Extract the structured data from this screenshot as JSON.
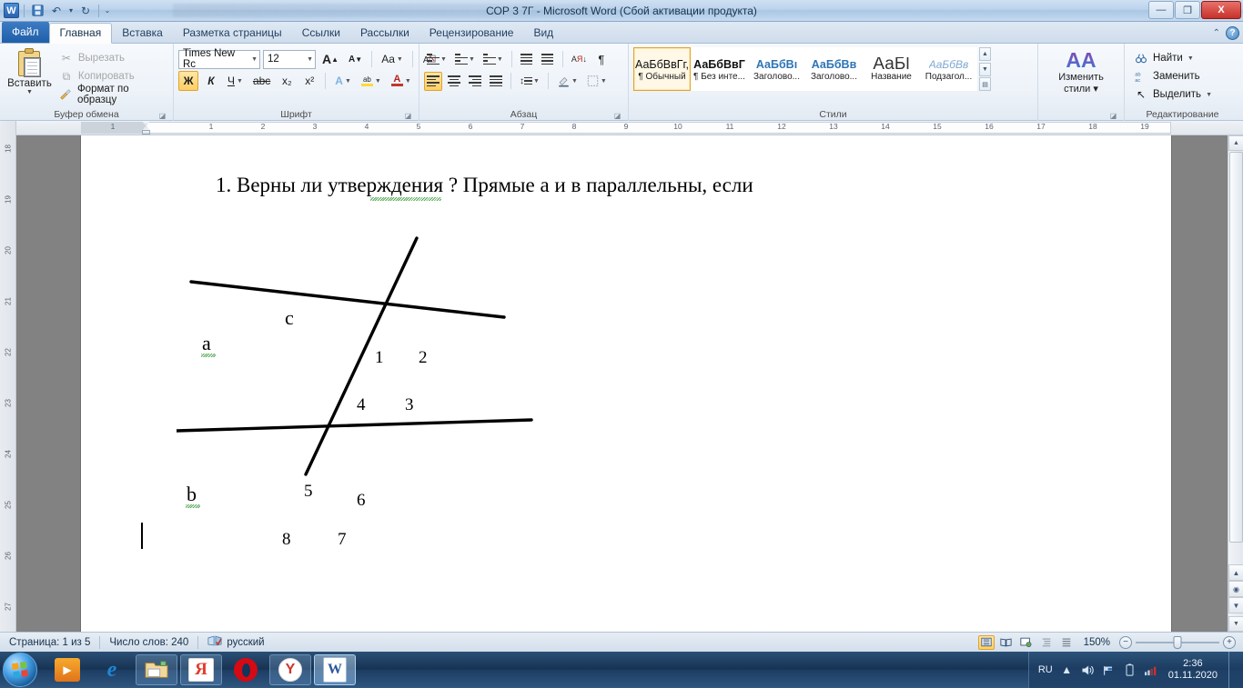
{
  "titlebar": {
    "app_icon": "word-icon",
    "title": "СОР 3 7Г  -  Microsoft Word (Сбой активации продукта)",
    "quick_access": [
      {
        "name": "save",
        "glyph": "🖫"
      },
      {
        "name": "undo",
        "glyph": "↶"
      },
      {
        "name": "redo",
        "glyph": "↻"
      },
      {
        "name": "customize",
        "glyph": "▾"
      }
    ],
    "window_buttons": {
      "minimize": "—",
      "restore": "❐",
      "close": "X"
    }
  },
  "tabs": [
    {
      "label": "Файл",
      "kind": "file"
    },
    {
      "label": "Главная",
      "kind": "active"
    },
    {
      "label": "Вставка",
      "kind": "normal"
    },
    {
      "label": "Разметка страницы",
      "kind": "normal"
    },
    {
      "label": "Ссылки",
      "kind": "normal"
    },
    {
      "label": "Рассылки",
      "kind": "normal"
    },
    {
      "label": "Рецензирование",
      "kind": "normal"
    },
    {
      "label": "Вид",
      "kind": "normal"
    }
  ],
  "ribbon_controls": {
    "collapse": "⌃",
    "help": "?"
  },
  "ribbon": {
    "clipboard": {
      "label": "Буфер обмена",
      "paste": {
        "label": "Вставить",
        "arrow": "▼"
      },
      "cut": {
        "label": "Вырезать",
        "icon": "✂"
      },
      "copy": {
        "label": "Копировать",
        "icon": "⧉"
      },
      "format_painter": {
        "label": "Формат по образцу",
        "icon": "🖌"
      }
    },
    "font": {
      "label": "Шрифт",
      "font_name": "Times New Rc",
      "font_size": "12",
      "grow": "A",
      "shrink": "A",
      "change_case": "Aa",
      "clear_format": "A⃠",
      "bold": "Ж",
      "italic": "К",
      "underline": "Ч",
      "strikethrough": "abc",
      "subscript": "x₂",
      "superscript": "x²",
      "text_effects": "A",
      "highlight": "ab",
      "font_color": "A",
      "active": [
        "bold"
      ]
    },
    "paragraph": {
      "label": "Абзац",
      "bullets": "≔",
      "numbering": "≕",
      "multilevel": "≖",
      "decrease_indent": "⇤",
      "increase_indent": "⇥",
      "sort": "A↓",
      "show_marks": "¶",
      "align_left": "≡",
      "align_center": "≡",
      "align_right": "≡",
      "justify": "≡",
      "line_spacing": "↕≡",
      "shading": "◨",
      "borders": "⊞",
      "active": [
        "align_left"
      ]
    },
    "styles": {
      "label": "Стили",
      "items": [
        {
          "preview": "АаБбВвГг,",
          "name": "¶ Обычный",
          "style": "normal",
          "selected": true
        },
        {
          "preview": "АаБбВвГ",
          "name": "¶ Без инте...",
          "style": "bold",
          "selected": false
        },
        {
          "preview": "АаБбВı",
          "name": "Заголово...",
          "style": "blue",
          "selected": false
        },
        {
          "preview": "АаБбВв",
          "name": "Заголово...",
          "style": "blue",
          "selected": false
        },
        {
          "preview": "АаБl",
          "name": "Название",
          "style": "big",
          "selected": false
        },
        {
          "preview": "АаБбВв",
          "name": "Подзагол...",
          "style": "ital",
          "selected": false
        }
      ],
      "nav": {
        "up": "▲",
        "down": "▼",
        "more": "▤"
      }
    },
    "editing": {
      "label": "Редактирование",
      "change_styles": {
        "label_1": "Изменить",
        "label_2": "стили",
        "icon": "AA"
      },
      "find": {
        "label": "Найти",
        "icon": "🔍"
      },
      "replace": {
        "label": "Заменить",
        "icon": "ab"
      },
      "select": {
        "label": "Выделить",
        "icon": "↖"
      }
    }
  },
  "rulers": {
    "tab_selector": "L",
    "horizontal_numbers": [
      "1",
      "1",
      "2",
      "3",
      "4",
      "5",
      "6",
      "7",
      "8",
      "9",
      "10",
      "11",
      "12",
      "13",
      "14",
      "15",
      "16",
      "17",
      "18",
      "19"
    ],
    "vertical_numbers": [
      "18",
      "19",
      "20",
      "21",
      "22",
      "23",
      "24",
      "25",
      "26",
      "27"
    ]
  },
  "document": {
    "text": "1.  Верны ли утверждения ?  Прямые а и в параллельны, если",
    "figure": {
      "labels": {
        "line_a": "a",
        "line_b": "b",
        "line_c": "c",
        "angles": [
          "1",
          "2",
          "3",
          "4",
          "5",
          "6",
          "7",
          "8"
        ]
      },
      "stroke_color": "#000000"
    }
  },
  "statusbar": {
    "page": "Страница: 1 из 5",
    "words": "Число слов: 240",
    "language": "русский",
    "proofing_icon": "book-check-icon",
    "views": [
      {
        "name": "print-layout",
        "glyph": "▤",
        "active": true
      },
      {
        "name": "full-screen-reading",
        "glyph": "📖",
        "active": false
      },
      {
        "name": "web-layout",
        "glyph": "🌐",
        "active": false
      },
      {
        "name": "outline",
        "glyph": "⊟",
        "active": false
      },
      {
        "name": "draft",
        "glyph": "≡",
        "active": false
      }
    ],
    "zoom": "150%",
    "zoom_out": "−",
    "zoom_in": "+"
  },
  "taskbar": {
    "start": "start-orb",
    "items": [
      {
        "name": "windows-media-player",
        "glyph": "▶"
      },
      {
        "name": "internet-explorer",
        "glyph": "e"
      },
      {
        "name": "file-explorer",
        "glyph": "📁"
      },
      {
        "name": "yandex",
        "glyph": "Я"
      },
      {
        "name": "opera",
        "glyph": "O"
      },
      {
        "name": "yandex-browser",
        "glyph": "Y"
      },
      {
        "name": "microsoft-word",
        "glyph": "W"
      }
    ],
    "tray": {
      "language": "RU",
      "show_hidden": "▲",
      "volume": "🔊",
      "network_flag": "⚑",
      "battery": "🔋",
      "signal": "▮",
      "time": "2:36",
      "date": "01.11.2020"
    }
  }
}
